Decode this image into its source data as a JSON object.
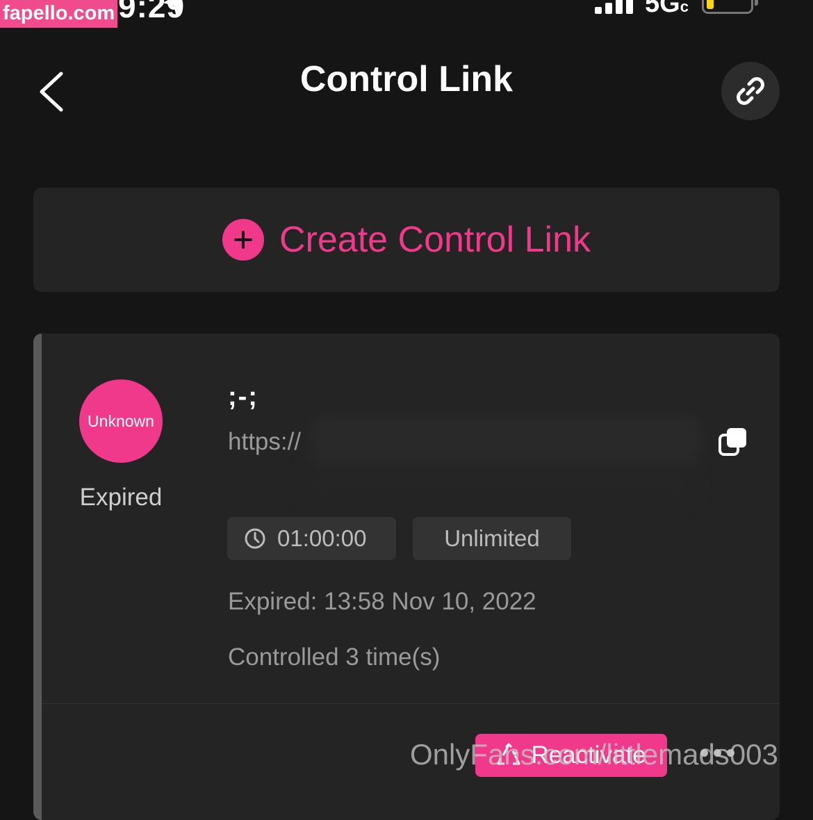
{
  "watermark_badge": "fapello.com",
  "status_bar": {
    "time": "9:29",
    "network": "5G",
    "network_suffix": "c",
    "colors": {
      "battery": "#ffd60a"
    }
  },
  "header": {
    "title": "Control Link",
    "back_icon": "chevron-left-icon",
    "action_icon": "link-icon"
  },
  "create_card": {
    "label": "Create Control Link",
    "icon": "plus-icon"
  },
  "link_card": {
    "avatar_text": "Unknown",
    "status": "Expired",
    "name": ";-;",
    "url": "https://",
    "copy_icon": "copy-icon",
    "duration": "01:00:00",
    "duration_icon": "clock-icon",
    "limit": "Unlimited",
    "expired_at": "Expired: 13:58 Nov 10, 2022",
    "control_count": "Controlled 3 time(s)",
    "reactivate_label": "Reactivate",
    "reactivate_icon": "recycle-icon",
    "more_icon": "more-dots-icon"
  },
  "footer_watermark": "OnlyFans.com/littlemads003",
  "colors": {
    "accent": "#f0398b",
    "background": "#151515",
    "card": "#242424"
  }
}
